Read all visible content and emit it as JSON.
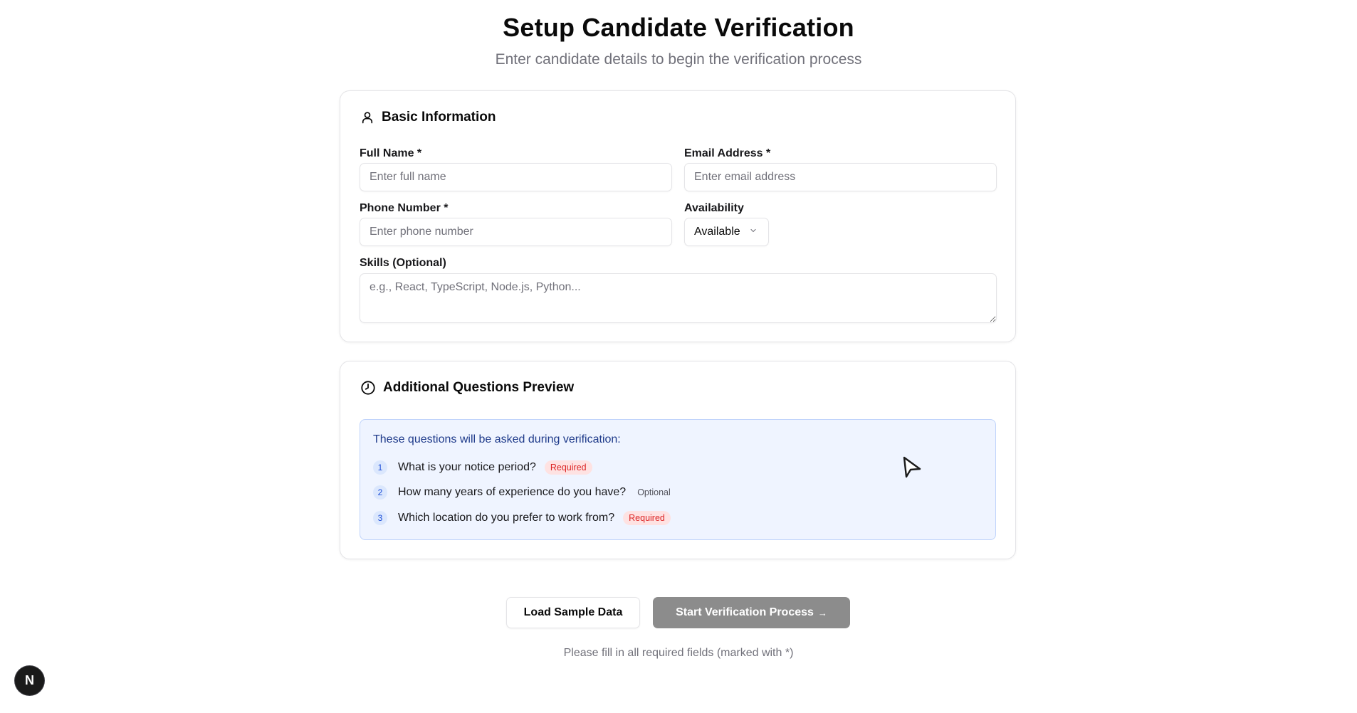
{
  "header": {
    "title": "Setup Candidate Verification",
    "subtitle": "Enter candidate details to begin the verification process"
  },
  "basic_info": {
    "section_title": "Basic Information",
    "section_icon": "user-icon",
    "full_name": {
      "label": "Full Name *",
      "value": "",
      "placeholder": "Enter full name"
    },
    "email": {
      "label": "Email Address *",
      "value": "",
      "placeholder": "Enter email address"
    },
    "phone": {
      "label": "Phone Number *",
      "value": "",
      "placeholder": "Enter phone number"
    },
    "availability": {
      "label": "Availability",
      "selected": "Available"
    },
    "skills": {
      "label": "Skills (Optional)",
      "value": "",
      "placeholder": "e.g., React, TypeScript, Node.js, Python..."
    }
  },
  "questions_preview": {
    "section_title": "Additional Questions Preview",
    "section_icon": "clock-icon",
    "heading": "These questions will be asked during verification:",
    "questions": [
      {
        "number": "1",
        "text": "What is your notice period?",
        "badge": "Required"
      },
      {
        "number": "2",
        "text": "How many years of experience do you have?",
        "badge": "Optional"
      },
      {
        "number": "3",
        "text": "Which location do you prefer to work from?",
        "badge": "Required"
      }
    ]
  },
  "actions": {
    "load_sample_label": "Load Sample Data",
    "start_label": "Start Verification Process",
    "start_arrow": "→"
  },
  "footer_note": "Please fill in all required fields (marked with *)",
  "dev_badge": {
    "letter": "N"
  },
  "colors": {
    "required_badge_bg": "#fee2e2",
    "required_badge_text": "#dc2626",
    "questions_box_bg": "#eff4ff",
    "questions_heading": "#1e3a8a",
    "start_button_disabled": "#8c8c8c"
  }
}
